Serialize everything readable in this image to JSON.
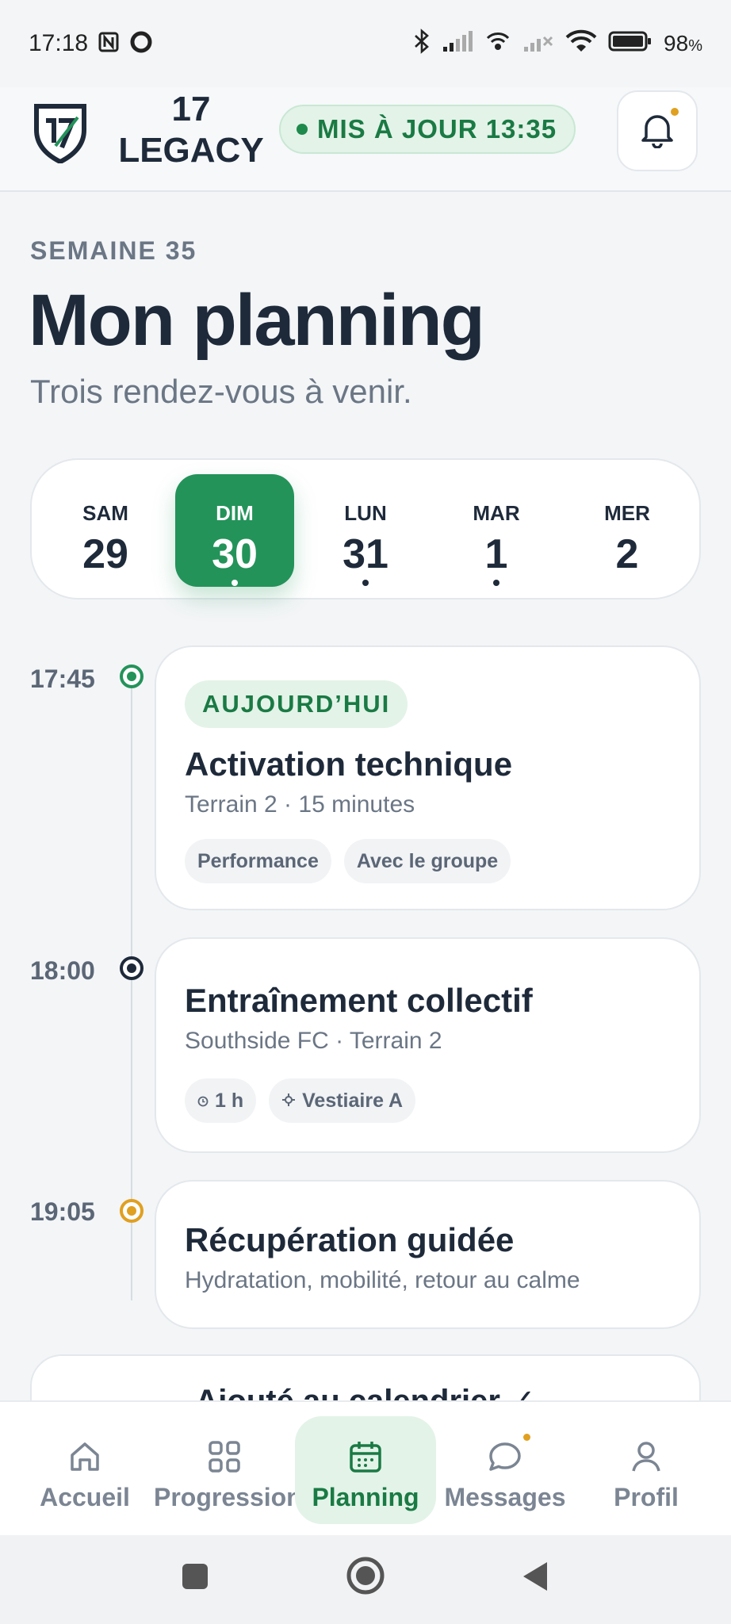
{
  "status_bar": {
    "time": "17:18",
    "battery": "98",
    "battery_unit": "%",
    "icons": [
      "nfc-icon",
      "record-icon",
      "bluetooth-icon",
      "signal-icon",
      "hotspot-icon",
      "signal-off-icon",
      "wifi-icon",
      "battery-icon"
    ]
  },
  "header": {
    "brand_line1": "17",
    "brand_line2": "LEGACY",
    "sync_label": "MIS À JOUR 13:35",
    "notifications_unread": true,
    "colors": {
      "accent": "#23935a",
      "accent_dark": "#1a7a44",
      "notice": "#e0a020"
    }
  },
  "page": {
    "week_label": "SEMAINE 35",
    "title": "Mon planning",
    "subtitle": "Trois rendez-vous à venir."
  },
  "days": [
    {
      "name": "SAM",
      "num": "29",
      "has_event": false,
      "active": false
    },
    {
      "name": "DIM",
      "num": "30",
      "has_event": true,
      "active": true
    },
    {
      "name": "LUN",
      "num": "31",
      "has_event": true,
      "active": false
    },
    {
      "name": "MAR",
      "num": "1",
      "has_event": true,
      "active": false
    },
    {
      "name": "MER",
      "num": "2",
      "has_event": false,
      "active": false
    }
  ],
  "events": [
    {
      "time": "17:45",
      "marker_color": "#23935a",
      "badge": "AUJOURD’HUI",
      "title": "Activation technique",
      "sub": "Terrain 2 · 15 minutes",
      "chips": [
        "Performance",
        "Avec le groupe"
      ]
    },
    {
      "time": "18:00",
      "marker_color": "#1e2a3a",
      "title": "Entraînement collectif",
      "sub": "Southside FC · Terrain 2",
      "chips": [
        "1 h",
        "Vestiaire A"
      ],
      "chip_icons": [
        "clock-icon",
        "location-icon"
      ]
    },
    {
      "time": "19:05",
      "marker_color": "#e0a020",
      "title": "Récupération guidée",
      "sub": "Hydratation, mobilité, retour au calme"
    }
  ],
  "peek_card": {
    "text": "Ajouté au calendrier ✓"
  },
  "nav": {
    "items": [
      {
        "label": "Accueil",
        "icon": "home-icon"
      },
      {
        "label": "Progression",
        "icon": "grid-icon"
      },
      {
        "label": "Planning",
        "icon": "calendar-icon",
        "active": true
      },
      {
        "label": "Messages",
        "icon": "chat-icon",
        "has_dot": true
      },
      {
        "label": "Profil",
        "icon": "user-icon"
      }
    ]
  }
}
